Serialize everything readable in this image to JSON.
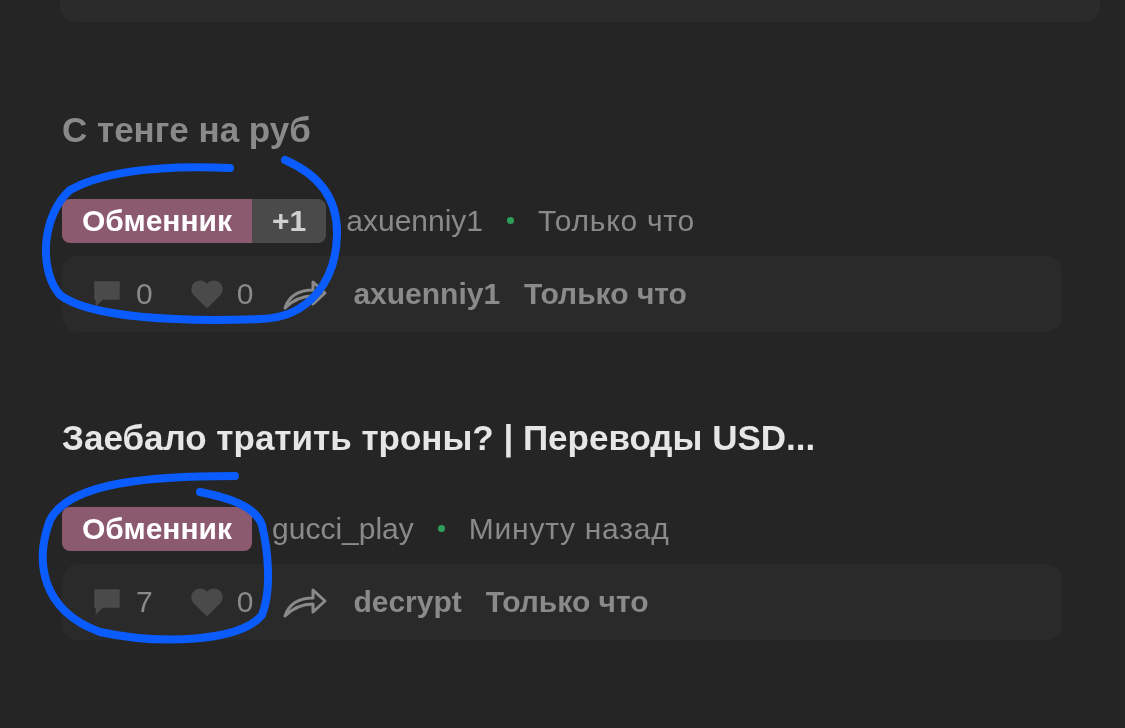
{
  "posts": [
    {
      "title": "С тенге на руб",
      "read": true,
      "tags": [
        {
          "label": "Обменник",
          "color": "#8c5a6e"
        }
      ],
      "extra_tags": "+1",
      "author": "axuenniy1",
      "time": "Только что",
      "comments": "0",
      "likes": "0",
      "last_author": "axuenniy1",
      "last_time": "Только что"
    },
    {
      "title": "Заебало тратить троны? | Переводы USD...",
      "read": false,
      "tags": [
        {
          "label": "Обменник",
          "color": "#8c5a6e"
        }
      ],
      "author": "gucci_play",
      "time": "Минуту назад",
      "comments": "7",
      "likes": "0",
      "last_author": "decrypt",
      "last_time": "Только что"
    }
  ]
}
